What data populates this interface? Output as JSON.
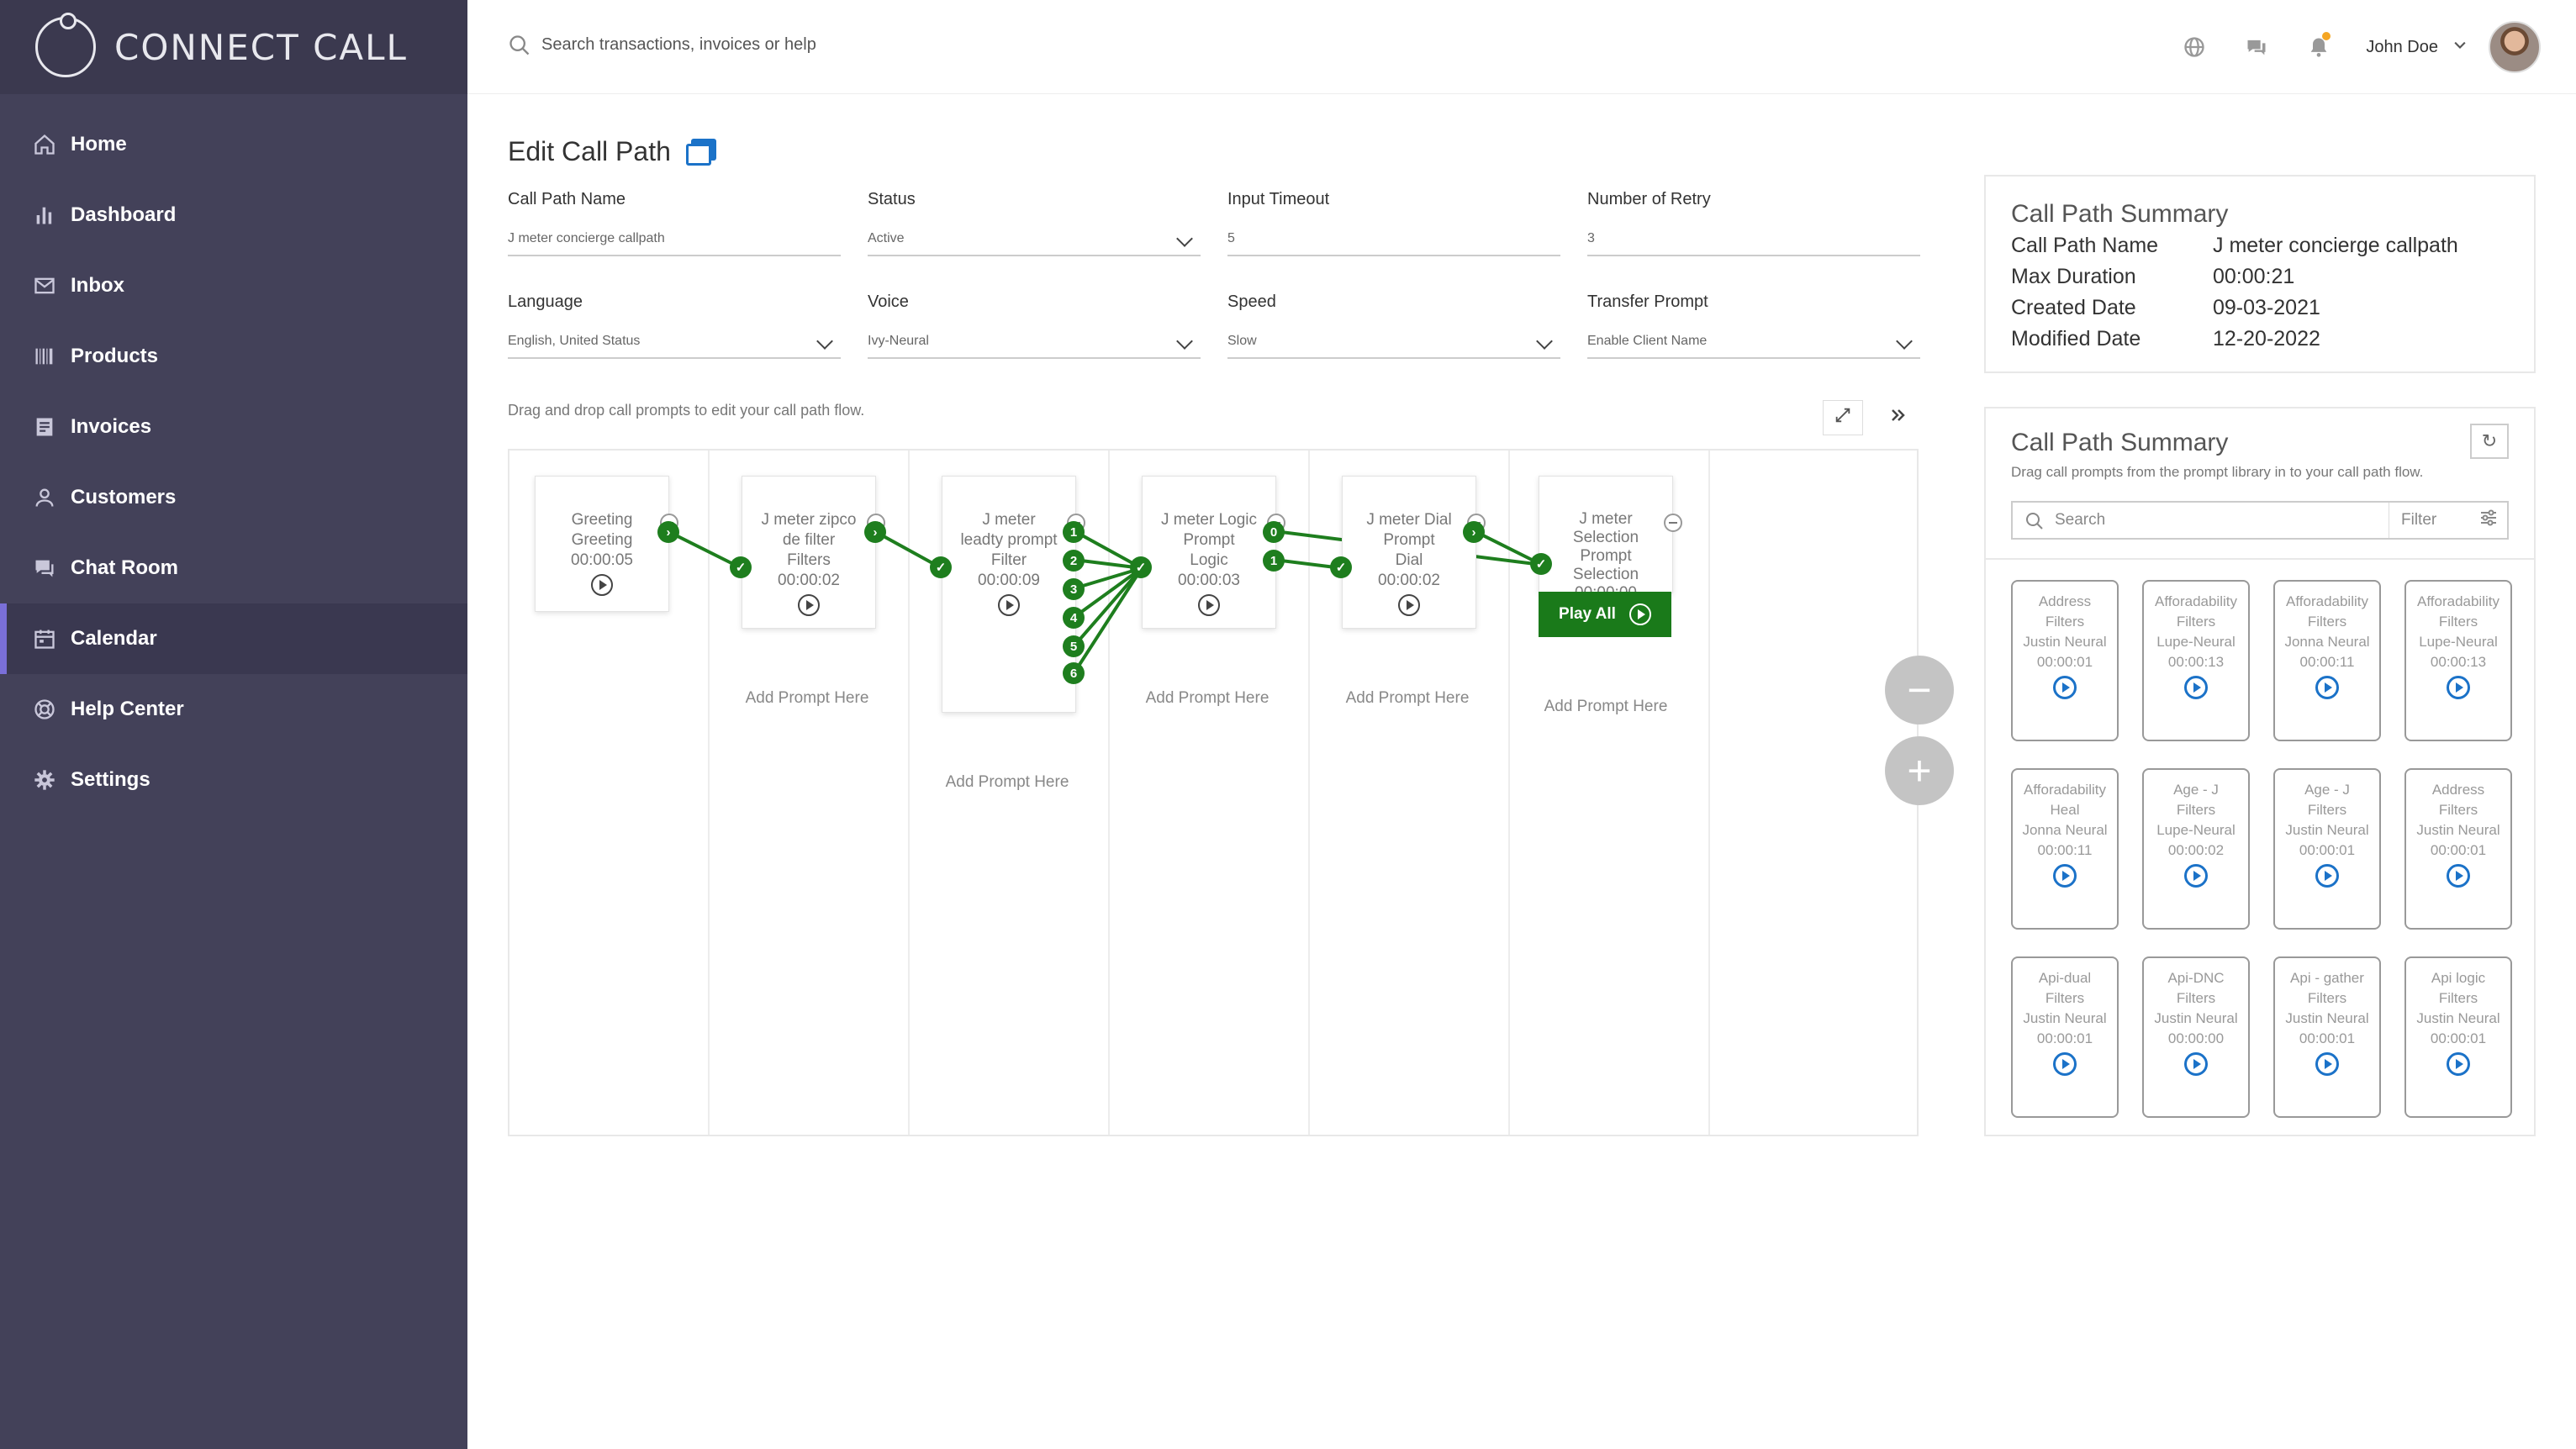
{
  "app": {
    "name": "CONNECT CALL"
  },
  "sidebar": {
    "items": [
      {
        "label": "Home",
        "icon": "home-icon"
      },
      {
        "label": "Dashboard",
        "icon": "bar-chart-icon"
      },
      {
        "label": "Inbox",
        "icon": "mail-icon"
      },
      {
        "label": "Products",
        "icon": "barcode-icon"
      },
      {
        "label": "Invoices",
        "icon": "invoice-icon"
      },
      {
        "label": "Customers",
        "icon": "user-icon"
      },
      {
        "label": "Chat Room",
        "icon": "chat-icon"
      },
      {
        "label": "Calendar",
        "icon": "calendar-icon",
        "active": true
      },
      {
        "label": "Help Center",
        "icon": "help-icon"
      },
      {
        "label": "Settings",
        "icon": "gear-icon"
      }
    ]
  },
  "header": {
    "search_placeholder": "Search transactions, invoices or help",
    "user_name": "John Doe",
    "notification_color": "#f5a623"
  },
  "page": {
    "title": "Edit Call Path"
  },
  "form": {
    "call_path_name": {
      "label": "Call Path Name",
      "value": "J meter concierge callpath"
    },
    "status": {
      "label": "Status",
      "value": "Active"
    },
    "input_timeout": {
      "label": "Input Timeout",
      "value": "5"
    },
    "number_of_retry": {
      "label": "Number of Retry",
      "value": "3"
    },
    "language": {
      "label": "Language",
      "value": "English, United Status"
    },
    "voice": {
      "label": "Voice",
      "value": "Ivy-Neural"
    },
    "speed": {
      "label": "Speed",
      "value": "Slow"
    },
    "transfer_prompt": {
      "label": "Transfer Prompt",
      "value": "Enable Client Name"
    }
  },
  "flow": {
    "hint": "Drag and drop call prompts to edit your call path flow.",
    "add_prompt": "Add Prompt Here",
    "play_all": "Play All",
    "accent": "#1e7e1e",
    "cards": [
      {
        "lines": [
          "Greeting",
          "Greeting",
          "00:00:05"
        ]
      },
      {
        "lines": [
          "J meter zipco",
          "de filter",
          "Filters",
          "00:00:02"
        ]
      },
      {
        "lines": [
          "J meter",
          "leadty prompt",
          "Filter",
          "00:00:09"
        ]
      },
      {
        "lines": [
          "J meter Logic",
          "Prompt",
          "Logic",
          "00:00:03"
        ]
      },
      {
        "lines": [
          "J meter Dial",
          "Prompt",
          "Dial",
          "00:00:02"
        ]
      },
      {
        "lines": [
          "J meter",
          "Selection",
          "Prompt",
          "Selection",
          "00:00:00"
        ]
      }
    ],
    "branch_nodes_a": [
      "1",
      "2",
      "3",
      "4",
      "5",
      "6"
    ],
    "branch_nodes_b": [
      "0",
      "1"
    ]
  },
  "summary": {
    "title": "Call Path Summary",
    "rows": [
      {
        "k": "Call Path Name",
        "v": "J meter concierge callpath"
      },
      {
        "k": "Max Duration",
        "v": "00:00:21"
      },
      {
        "k": "Created Date",
        "v": "09-03-2021"
      },
      {
        "k": "Modified Date",
        "v": "12-20-2022"
      }
    ]
  },
  "library": {
    "title": "Call Path Summary",
    "subtitle": "Drag call prompts from the prompt library in to your call path flow.",
    "search_placeholder": "Search",
    "filter_label": "Filter",
    "items": [
      {
        "lines": [
          "Address",
          "Filters",
          "Justin Neural",
          "00:00:01"
        ]
      },
      {
        "lines": [
          "Afforadability",
          "Filters",
          "Lupe-Neural",
          "00:00:13"
        ]
      },
      {
        "lines": [
          "Afforadability",
          "Filters",
          "Jonna Neural",
          "00:00:11"
        ]
      },
      {
        "lines": [
          "Afforadability",
          "Filters",
          "Lupe-Neural",
          "00:00:13"
        ]
      },
      {
        "lines": [
          "Afforadability",
          "Heal",
          "Jonna Neural",
          "00:00:11"
        ]
      },
      {
        "lines": [
          "Age - J",
          "Filters",
          "Lupe-Neural",
          "00:00:02"
        ]
      },
      {
        "lines": [
          "Age - J",
          "Filters",
          "Justin Neural",
          "00:00:01"
        ]
      },
      {
        "lines": [
          "Address",
          "Filters",
          "Justin Neural",
          "00:00:01"
        ]
      },
      {
        "lines": [
          "Api-dual",
          "Filters",
          "Justin Neural",
          "00:00:01"
        ]
      },
      {
        "lines": [
          "Api-DNC",
          "Filters",
          "Justin Neural",
          "00:00:00"
        ]
      },
      {
        "lines": [
          "Api - gather",
          "Filters",
          "Justin Neural",
          "00:00:01"
        ]
      },
      {
        "lines": [
          "Api logic",
          "Filters",
          "Justin Neural",
          "00:00:01"
        ]
      }
    ]
  }
}
